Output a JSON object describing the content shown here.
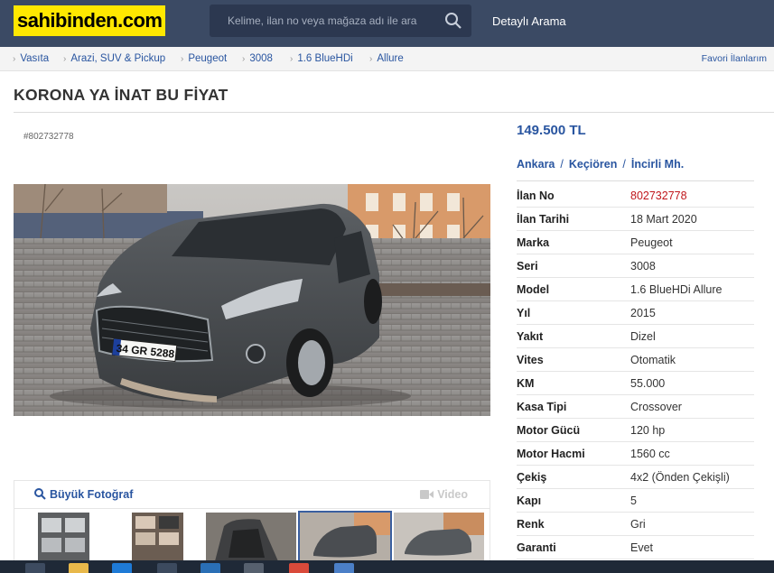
{
  "header": {
    "logo": "sahibinden.com",
    "search_placeholder": "Kelime, ilan no veya mağaza adı ile ara",
    "detail_search": "Detaylı Arama"
  },
  "breadcrumb": {
    "items": [
      "Vasıta",
      "Arazi, SUV & Pickup",
      "Peugeot",
      "3008",
      "1.6 BlueHDi",
      "Allure"
    ],
    "favorites": "Favori İlanlarım"
  },
  "listing": {
    "title": "KORONA YA İNAT BU FİYAT",
    "ad_no_small": "#802732778",
    "price": "149.500 TL",
    "location": [
      "Ankara",
      "Keçiören",
      "İncirli Mh."
    ],
    "big_photo": "Büyük Fotoğraf",
    "video": "Video",
    "plate": "34 GR 5288"
  },
  "specs": [
    {
      "k": "İlan No",
      "v": "802732778",
      "accent": true
    },
    {
      "k": "İlan Tarihi",
      "v": "18 Mart 2020"
    },
    {
      "k": "Marka",
      "v": "Peugeot"
    },
    {
      "k": "Seri",
      "v": "3008"
    },
    {
      "k": "Model",
      "v": "1.6 BlueHDi Allure"
    },
    {
      "k": "Yıl",
      "v": "2015"
    },
    {
      "k": "Yakıt",
      "v": "Dizel"
    },
    {
      "k": "Vites",
      "v": "Otomatik"
    },
    {
      "k": "KM",
      "v": "55.000"
    },
    {
      "k": "Kasa Tipi",
      "v": "Crossover"
    },
    {
      "k": "Motor Gücü",
      "v": "120 hp"
    },
    {
      "k": "Motor Hacmi",
      "v": "1560 cc"
    },
    {
      "k": "Çekiş",
      "v": "4x2 (Önden Çekişli)"
    },
    {
      "k": "Kapı",
      "v": "5"
    },
    {
      "k": "Renk",
      "v": "Gri"
    },
    {
      "k": "Garanti",
      "v": "Evet"
    }
  ],
  "colors": {
    "header_bg": "#3b4a64",
    "logo_bg": "#ffe800",
    "link": "#2955a0",
    "accent_red": "#c0161b"
  }
}
